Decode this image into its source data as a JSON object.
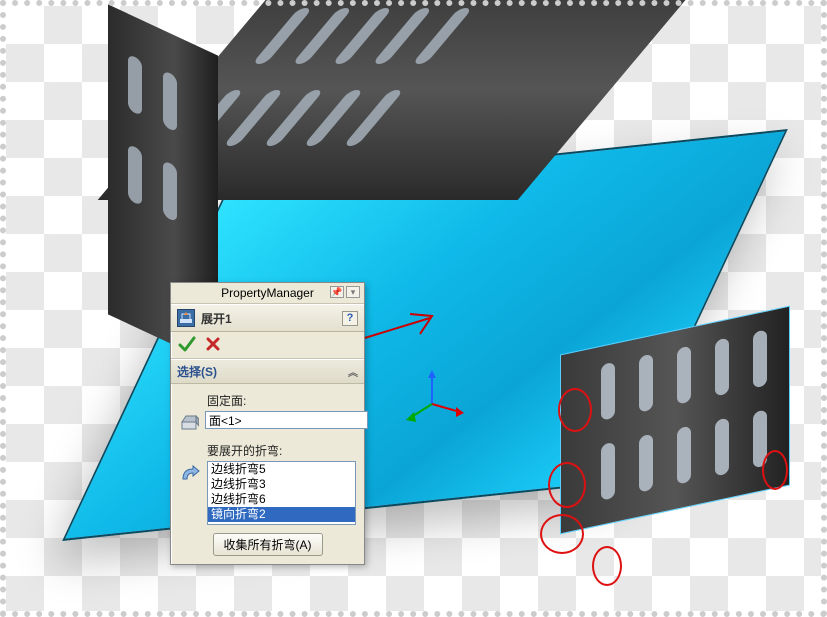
{
  "panel": {
    "title": "PropertyManager",
    "feature_name": "展开1",
    "help_label": "?",
    "group_label": "选择(S)",
    "fixed_face_label": "固定面:",
    "fixed_face_value": "面<1>",
    "bends_label": "要展开的折弯:",
    "bend_items": [
      "边线折弯5",
      "边线折弯3",
      "边线折弯6",
      "镜向折弯2"
    ],
    "bend_selected_index": 3,
    "collect_label": "收集所有折弯(A)"
  },
  "icons": {
    "unfold": "unfold-icon",
    "ok": "ok-icon",
    "cancel": "cancel-icon",
    "face_picker": "face-picker-icon",
    "bend_picker": "bend-picker-icon",
    "pushpin": "pushpin-icon",
    "chevron": "chevron-up-icon"
  },
  "colors": {
    "panel_bg": "#ece9d8",
    "accent": "#2f6ac0",
    "highlight_face": "#1fd4ff",
    "annotation": "#d11"
  }
}
